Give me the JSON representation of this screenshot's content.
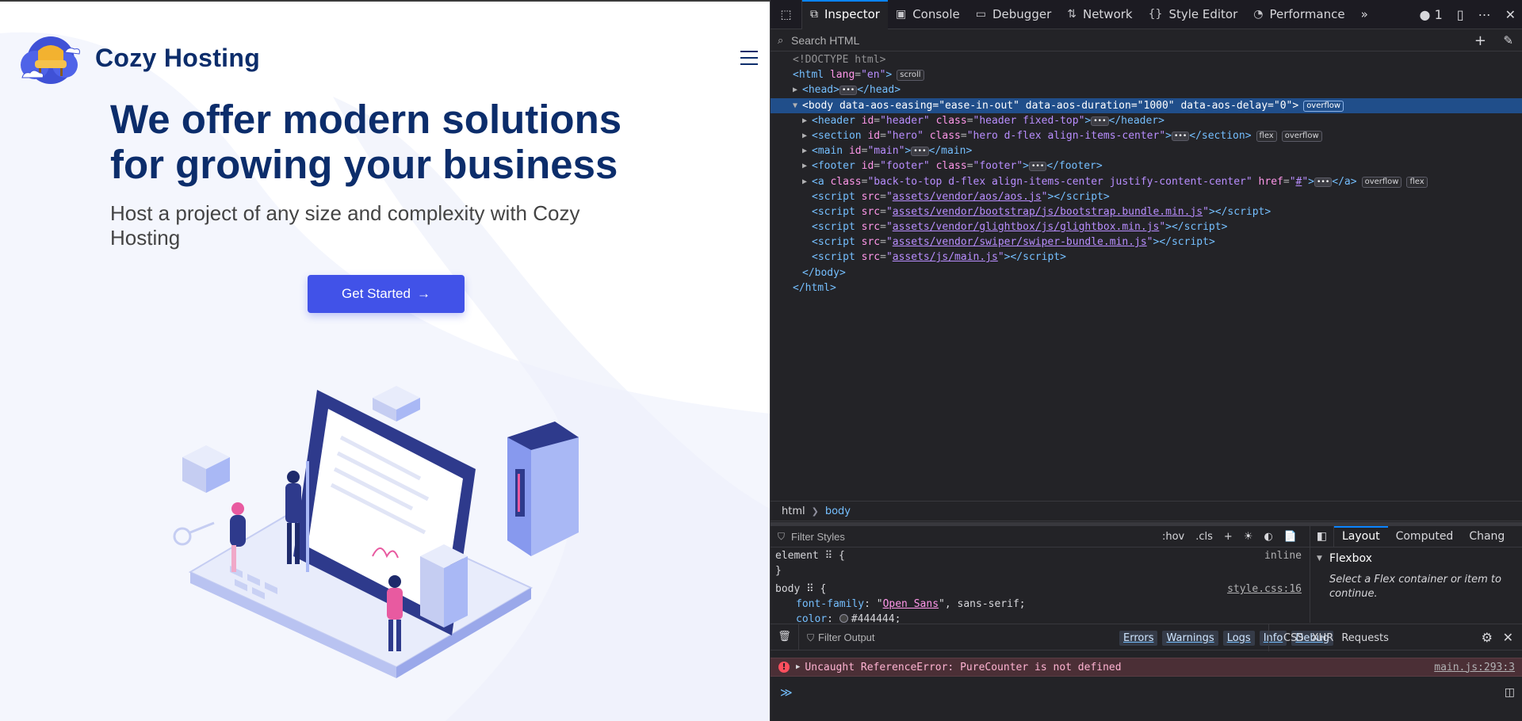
{
  "site": {
    "brand": "Cozy Hosting",
    "hero_title": "We offer modern solutions for growing your business",
    "hero_subtitle": "Host a project of any size and complexity with Cozy Hosting",
    "cta_label": "Get Started",
    "cta_arrow": "→",
    "menu_icon": "hamburger-menu-icon"
  },
  "devtools": {
    "tabs": [
      {
        "label": "Inspector",
        "icon": "inspector-icon",
        "active": true
      },
      {
        "label": "Console",
        "icon": "console-icon"
      },
      {
        "label": "Debugger",
        "icon": "debugger-icon"
      },
      {
        "label": "Network",
        "icon": "network-icon"
      },
      {
        "label": "Style Editor",
        "icon": "style-editor-icon"
      },
      {
        "label": "Performance",
        "icon": "performance-icon"
      }
    ],
    "more_tabs": "»",
    "error_count": "1",
    "search_placeholder": "Search HTML",
    "markup": [
      {
        "indent": 0,
        "twisty": "",
        "html": "<span class='t-doc'>&lt;!DOCTYPE html&gt;</span>"
      },
      {
        "indent": 0,
        "twisty": "",
        "html": "<span class='t-tag'>&lt;html</span> <span class='t-attr'>lang</span><span class='t-pun'>=</span><span class='t-val'>\"en\"</span><span class='t-tag'>&gt;</span><span class='badge'>scroll</span>"
      },
      {
        "indent": 1,
        "twisty": "▶",
        "html": "<span class='t-tag'>&lt;head&gt;</span><span class='dots'>•••</span><span class='t-tag'>&lt;/head&gt;</span>"
      },
      {
        "indent": 1,
        "twisty": "▼",
        "selected": true,
        "html": "<span class='t-tag'>&lt;body</span> <span class='t-attr'>data-aos-easing</span><span class='t-pun'>=</span><span class='t-val'>\"ease-in-out\"</span> <span class='t-attr'>data-aos-duration</span><span class='t-pun'>=</span><span class='t-val'>\"1000\"</span> <span class='t-attr'>data-aos-delay</span><span class='t-pun'>=</span><span class='t-val'>\"0\"</span><span class='t-tag'>&gt;</span><span class='badge'>overflow</span>"
      },
      {
        "indent": 2,
        "twisty": "▶",
        "html": "<span class='t-tag'>&lt;header</span> <span class='t-attr'>id</span><span class='t-pun'>=</span><span class='t-val'>\"header\"</span> <span class='t-attr'>class</span><span class='t-pun'>=</span><span class='t-val'>\"header fixed-top\"</span><span class='t-tag'>&gt;</span><span class='dots'>•••</span><span class='t-tag'>&lt;/header&gt;</span>"
      },
      {
        "indent": 2,
        "twisty": "▶",
        "html": "<span class='t-tag'>&lt;section</span> <span class='t-attr'>id</span><span class='t-pun'>=</span><span class='t-val'>\"hero\"</span> <span class='t-attr'>class</span><span class='t-pun'>=</span><span class='t-val'>\"hero d-flex align-items-center\"</span><span class='t-tag'>&gt;</span><span class='dots'>•••</span><span class='t-tag'>&lt;/section&gt;</span><span class='badge'>flex</span><span class='badge'>overflow</span>"
      },
      {
        "indent": 2,
        "twisty": "▶",
        "html": "<span class='t-tag'>&lt;main</span> <span class='t-attr'>id</span><span class='t-pun'>=</span><span class='t-val'>\"main\"</span><span class='t-tag'>&gt;</span><span class='dots'>•••</span><span class='t-tag'>&lt;/main&gt;</span>"
      },
      {
        "indent": 2,
        "twisty": "▶",
        "html": "<span class='t-tag'>&lt;footer</span> <span class='t-attr'>id</span><span class='t-pun'>=</span><span class='t-val'>\"footer\"</span> <span class='t-attr'>class</span><span class='t-pun'>=</span><span class='t-val'>\"footer\"</span><span class='t-tag'>&gt;</span><span class='dots'>•••</span><span class='t-tag'>&lt;/footer&gt;</span>"
      },
      {
        "indent": 2,
        "twisty": "▶",
        "html": "<span class='t-tag'>&lt;a</span> <span class='t-attr'>class</span><span class='t-pun'>=</span><span class='t-val'>\"back-to-top d-flex align-items-center justify-content-center\"</span> <span class='t-attr'>href</span><span class='t-pun'>=</span><span class='t-val'>\"<u>#</u>\"</span><span class='t-tag'>&gt;</span><span class='dots'>•••</span><span class='t-tag'>&lt;/a&gt;</span><span class='badge'>overflow</span><span class='badge'>flex</span>"
      },
      {
        "indent": 2,
        "twisty": "",
        "html": "<span class='t-tag'>&lt;script</span> <span class='t-attr'>src</span><span class='t-pun'>=</span><span class='t-val'>\"</span><span class='t-link'>assets/vendor/aos/aos.js</span><span class='t-val'>\"</span><span class='t-tag'>&gt;&lt;/script&gt;</span>"
      },
      {
        "indent": 2,
        "twisty": "",
        "html": "<span class='t-tag'>&lt;script</span> <span class='t-attr'>src</span><span class='t-pun'>=</span><span class='t-val'>\"</span><span class='t-link'>assets/vendor/bootstrap/js/bootstrap.bundle.min.js</span><span class='t-val'>\"</span><span class='t-tag'>&gt;&lt;/script&gt;</span>"
      },
      {
        "indent": 2,
        "twisty": "",
        "html": "<span class='t-tag'>&lt;script</span> <span class='t-attr'>src</span><span class='t-pun'>=</span><span class='t-val'>\"</span><span class='t-link'>assets/vendor/glightbox/js/glightbox.min.js</span><span class='t-val'>\"</span><span class='t-tag'>&gt;&lt;/script&gt;</span>"
      },
      {
        "indent": 2,
        "twisty": "",
        "html": "<span class='t-tag'>&lt;script</span> <span class='t-attr'>src</span><span class='t-pun'>=</span><span class='t-val'>\"</span><span class='t-link'>assets/vendor/swiper/swiper-bundle.min.js</span><span class='t-val'>\"</span><span class='t-tag'>&gt;&lt;/script&gt;</span>"
      },
      {
        "indent": 2,
        "twisty": "",
        "html": "<span class='t-tag'>&lt;script</span> <span class='t-attr'>src</span><span class='t-pun'>=</span><span class='t-val'>\"</span><span class='t-link'>assets/js/main.js</span><span class='t-val'>\"</span><span class='t-tag'>&gt;&lt;/script&gt;</span>"
      },
      {
        "indent": 1,
        "twisty": "",
        "html": "<span class='t-tag'>&lt;/body&gt;</span>"
      },
      {
        "indent": 0,
        "twisty": "",
        "html": "<span class='t-tag'>&lt;/html&gt;</span>"
      }
    ],
    "breadcrumbs": [
      "html",
      "body"
    ],
    "filter_styles_placeholder": "Filter Styles",
    "rule_buttons": [
      ":hov",
      ".cls",
      "+",
      "☀",
      "◐",
      "📄"
    ],
    "rules": {
      "element_selector": "element",
      "element_open": "{",
      "element_close": "}",
      "element_source": "inline",
      "body_selector": "body",
      "body_source": "style.css:16",
      "font_family_prop": "font-family",
      "font_family_str": "Open Sans",
      "font_family_rest": ", sans-serif;",
      "color_prop": "color",
      "color_value": "#444444;",
      "color_hex": "#444444"
    },
    "layout_tabs": [
      "Layout",
      "Computed",
      "Chang"
    ],
    "layout_active": "Layout",
    "flexbox_heading": "Flexbox",
    "flexbox_note": "Select a Flex container or item to continue.",
    "console_filter_placeholder": "Filter Output",
    "levels": [
      "Errors",
      "Warnings",
      "Logs",
      "Info",
      "Debug"
    ],
    "request_filters": [
      "CSS",
      "XHR",
      "Requests"
    ],
    "error_message": "Uncaught ReferenceError: PureCounter is not defined",
    "error_location": "main.js:293:3",
    "prompt_symbol": "≫"
  }
}
